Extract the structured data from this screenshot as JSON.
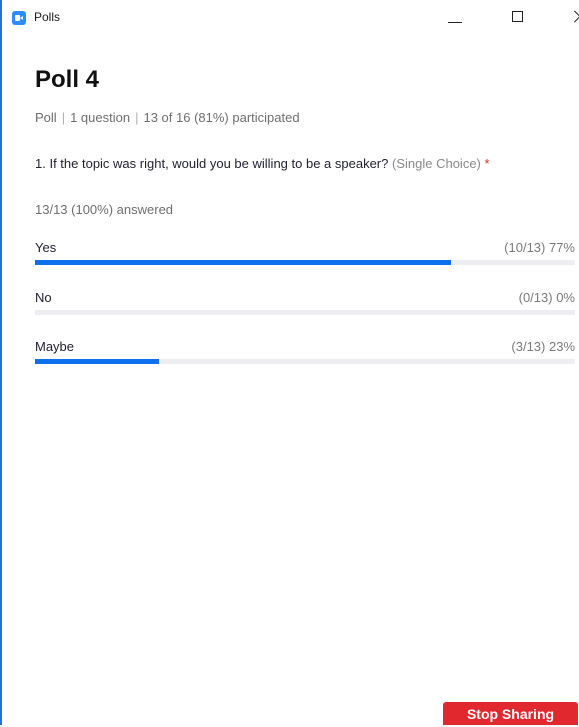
{
  "window": {
    "title": "Polls",
    "accent_color": "#2d8cff"
  },
  "poll": {
    "title": "Poll 4",
    "meta": {
      "type": "Poll",
      "question_count": "1 question",
      "participation": "13 of 16 (81%) participated"
    },
    "question": {
      "text": "1. If the topic was right, would you be willing to be a speaker?",
      "type_label": "(Single Choice)",
      "required_mark": "*",
      "answered": "13/13 (100%) answered"
    },
    "options": [
      {
        "label": "Yes",
        "result": "(10/13) 77%",
        "fraction": 0.77
      },
      {
        "label": "No",
        "result": "(0/13) 0%",
        "fraction": 0.0
      },
      {
        "label": "Maybe",
        "result": "(3/13) 23%",
        "fraction": 0.23
      }
    ],
    "bar_color": "#0e71eb"
  },
  "footer": {
    "stop_sharing_label": "Stop Sharing",
    "stop_sharing_color": "#e0282e"
  }
}
